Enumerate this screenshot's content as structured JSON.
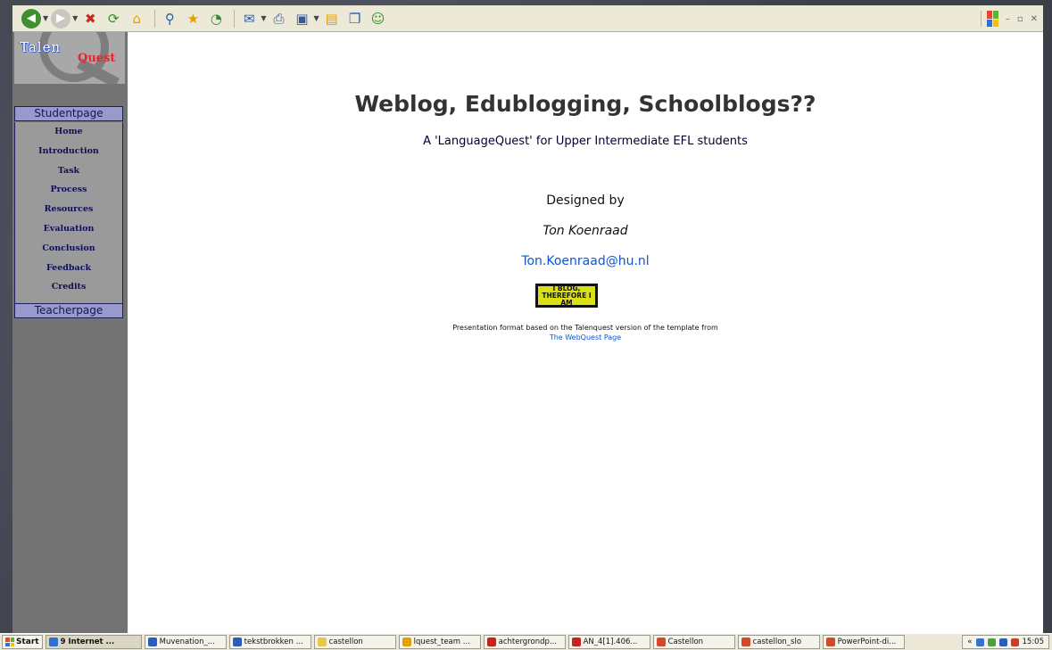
{
  "toolbar": {
    "buttons": [
      {
        "name": "back-arrow-icon",
        "glyph": "◀"
      },
      {
        "name": "forward-arrow-icon",
        "glyph": "▶"
      },
      {
        "name": "stop-icon",
        "glyph": "✖"
      },
      {
        "name": "refresh-icon",
        "glyph": "⟳"
      },
      {
        "name": "home-icon",
        "glyph": "⌂"
      },
      {
        "name": "search-icon",
        "glyph": "⚲"
      },
      {
        "name": "favorites-star-icon",
        "glyph": "★"
      },
      {
        "name": "history-icon",
        "glyph": "◔"
      },
      {
        "name": "mail-icon",
        "glyph": "✉"
      },
      {
        "name": "print-icon",
        "glyph": "⎙"
      },
      {
        "name": "page-icon",
        "glyph": "▣"
      },
      {
        "name": "notes-icon",
        "glyph": "▤"
      },
      {
        "name": "research-icon",
        "glyph": "❐"
      },
      {
        "name": "messenger-icon",
        "glyph": "☺"
      }
    ],
    "window_controls": {
      "minimize": "–",
      "restore": "▫",
      "close": "✕"
    }
  },
  "sidebar": {
    "logo_text": "TalenQuest",
    "logo_word": "Talen",
    "logo_q": "Q",
    "logo_rest": "uest",
    "studentpage_label": "Studentpage",
    "teacherpage_label": "Teacherpage",
    "items": [
      {
        "label": "Home"
      },
      {
        "label": "Introduction"
      },
      {
        "label": "Task"
      },
      {
        "label": "Process"
      },
      {
        "label": "Resources"
      },
      {
        "label": "Evaluation"
      },
      {
        "label": "Conclusion"
      },
      {
        "label": "Feedback"
      },
      {
        "label": "Credits"
      }
    ]
  },
  "main": {
    "title": "Weblog, Edublogging, Schoolblogs??",
    "subtitle": "A 'LanguageQuest' for Upper Intermediate EFL students",
    "designed_by": "Designed by",
    "author": "Ton Koenraad",
    "email": "Ton.Koenraad@hu.nl",
    "badge_line1": "I BLOG,",
    "badge_line2": "THEREFORE I AM",
    "footer_text": "Presentation format based on the Talenquest version of the template from",
    "footer_link": "The WebQuest Page"
  },
  "taskbar": {
    "start_label": "Start",
    "tasks": [
      {
        "label": "9 Internet ...",
        "active": true,
        "color": "#2e6fd6"
      },
      {
        "label": "Muvenation_...",
        "active": false,
        "color": "#2a5bbd"
      },
      {
        "label": "tekstbrokken ...",
        "active": false,
        "color": "#2a5bbd"
      },
      {
        "label": "castellon",
        "active": false,
        "color": "#e8c84a"
      },
      {
        "label": "lquest_team ...",
        "active": false,
        "color": "#e0a100"
      },
      {
        "label": "achtergrondp...",
        "active": false,
        "color": "#c8231b"
      },
      {
        "label": "AN_4[1].406...",
        "active": false,
        "color": "#c8231b"
      },
      {
        "label": "Castellon",
        "active": false,
        "color": "#d04a2a"
      },
      {
        "label": "castellon_slo",
        "active": false,
        "color": "#d04a2a"
      },
      {
        "label": "PowerPoint-di...",
        "active": false,
        "color": "#d04a2a"
      }
    ],
    "clock": "15:05"
  }
}
